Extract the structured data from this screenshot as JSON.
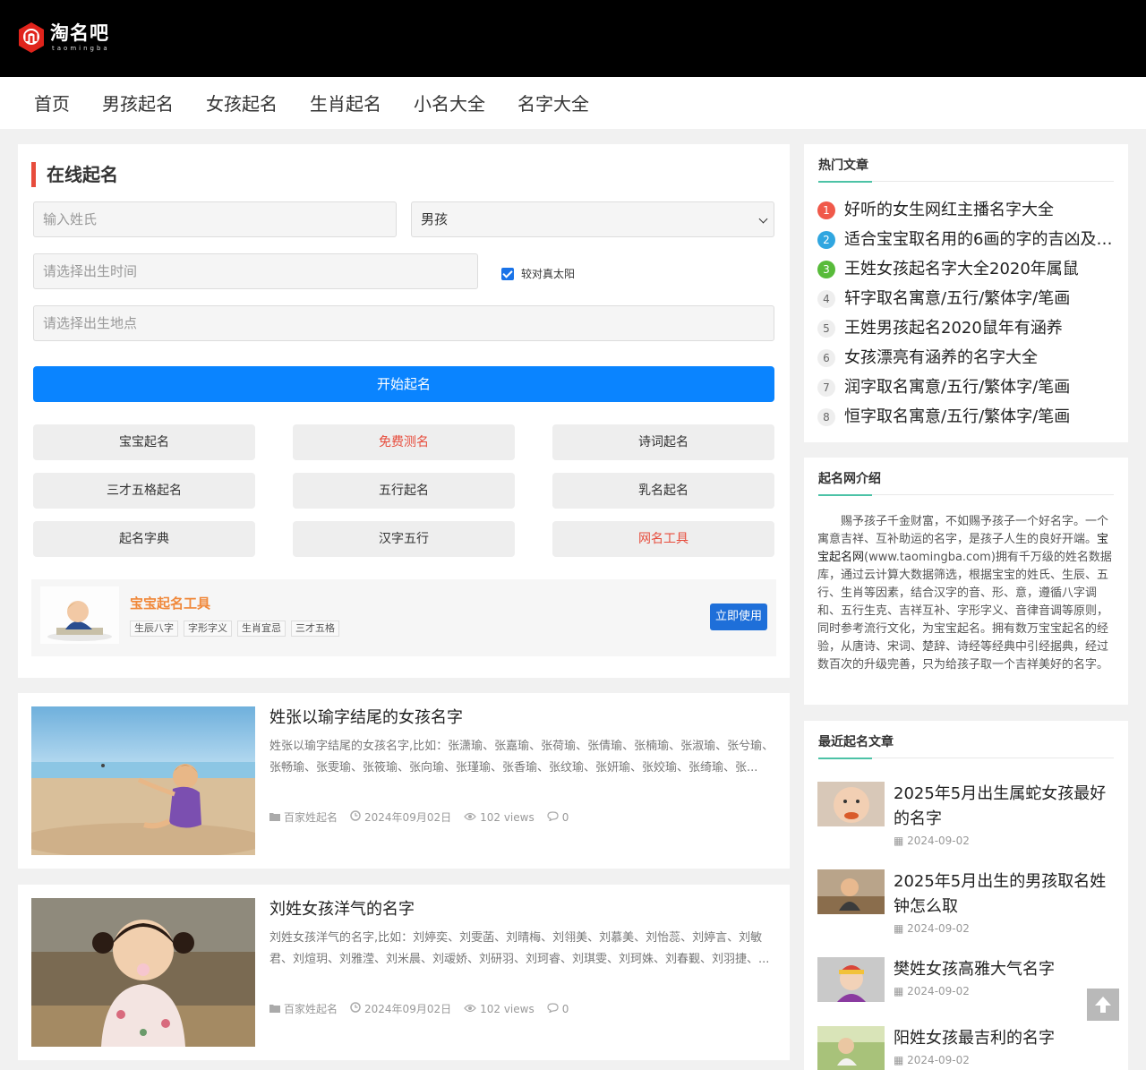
{
  "header": {
    "logo_cn": "淘名吧",
    "logo_en": "taomingba",
    "brand_color": "#e0231b"
  },
  "nav": [
    "首页",
    "男孩起名",
    "女孩起名",
    "生肖起名",
    "小名大全",
    "名字大全"
  ],
  "naming": {
    "title": "在线起名",
    "surname_placeholder": "输入姓氏",
    "gender_value": "男孩",
    "birth_time_placeholder": "请选择出生时间",
    "solar_label": "较对真太阳",
    "solar_checked": true,
    "birth_place_placeholder": "请选择出生地点",
    "start_label": "开始起名",
    "tools": [
      {
        "label": "宝宝起名",
        "highlight": false
      },
      {
        "label": "免费测名",
        "highlight": true
      },
      {
        "label": "诗词起名",
        "highlight": false
      },
      {
        "label": "三才五格起名",
        "highlight": false
      },
      {
        "label": "五行起名",
        "highlight": false
      },
      {
        "label": "乳名起名",
        "highlight": false
      },
      {
        "label": "起名字典",
        "highlight": false
      },
      {
        "label": "汉字五行",
        "highlight": false
      },
      {
        "label": "网名工具",
        "highlight": true
      }
    ],
    "promo": {
      "title": "宝宝起名工具",
      "tags": [
        "生辰八字",
        "字形字义",
        "生肖宜忌",
        "三才五格"
      ],
      "button": "立即使用"
    }
  },
  "articles": [
    {
      "title": "姓张以瑜字结尾的女孩名字",
      "excerpt": "姓张以瑜字结尾的女孩名字,比如：张潇瑜、张嘉瑜、张荷瑜、张倩瑜、张楠瑜、张淑瑜、张兮瑜、张畅瑜、张雯瑜、张筱瑜、张向瑜、张瑾瑜、张香瑜、张纹瑜、张妍瑜、张姣瑜、张绮瑜、张...",
      "category": "百家姓起名",
      "date": "2024年09月02日",
      "views": "102 views",
      "comments": "0"
    },
    {
      "title": "刘姓女孩洋气的名字",
      "excerpt": "刘姓女孩洋气的名字,比如：刘婷奕、刘雯菡、刘晴梅、刘翎美、刘慕美、刘怡蕊、刘婷言、刘敏君、刘煊玥、刘雅滢、刘米晨、刘叆娇、刘研羽、刘珂睿、刘琪雯、刘珂姝、刘春觐、刘羽捷、...",
      "category": "百家姓起名",
      "date": "2024年09月02日",
      "views": "102 views",
      "comments": "0"
    }
  ],
  "sidebar": {
    "hot_title": "热门文章",
    "hot": [
      "好听的女生网红主播名字大全",
      "适合宝宝取名用的6画的字的吉凶及含义",
      "王姓女孩起名字大全2020年属鼠",
      "轩字取名寓意/五行/繁体字/笔画",
      "王姓男孩起名2020鼠年有涵养",
      "女孩漂亮有涵养的名字大全",
      "润字取名寓意/五行/繁体字/笔画",
      "恒字取名寓意/五行/繁体字/笔画"
    ],
    "intro_title": "起名网介绍",
    "intro_part1": "赐予孩子千金财富，不如赐予孩子一个好名字。一个寓意吉祥、互补助运的名字，是孩子人生的良好开端。",
    "intro_brand": "宝宝起名网",
    "intro_part2": "(www.taomingba.com)拥有千万级的姓名数据库，通过云计算大数据筛选，根据宝宝的姓氏、生辰、五行、生肖等因素，结合汉字的音、形、意，遵循八字调和、五行生克、吉祥互补、字形字义、音律音调等原则，同时参考流行文化，为宝宝起名。拥有数万宝宝起名的经验，从唐诗、宋词、楚辞、诗经等经典中引经据典，经过数百次的升级完善，只为给孩子取一个吉祥美好的名字。",
    "recent_title": "最近起名文章",
    "recent": [
      {
        "title": "2025年5月出生属蛇女孩最好的名字",
        "date": "2024-09-02"
      },
      {
        "title": "2025年5月出生的男孩取名姓钟怎么取",
        "date": "2024-09-02"
      },
      {
        "title": "樊姓女孩高雅大气名字",
        "date": "2024-09-02"
      },
      {
        "title": "阳姓女孩最吉利的名字",
        "date": "2024-09-02"
      }
    ]
  }
}
